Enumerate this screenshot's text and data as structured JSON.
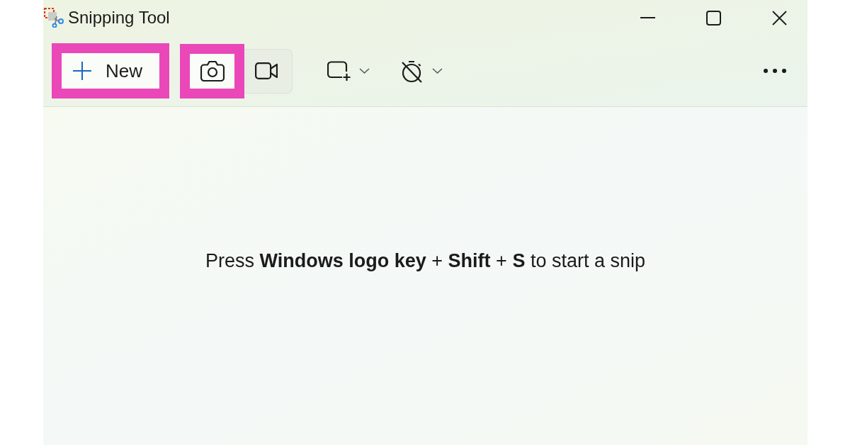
{
  "window": {
    "title": "Snipping Tool"
  },
  "toolbar": {
    "new_button": {
      "label": "New",
      "highlighted": true
    },
    "capture_modes": [
      {
        "kind": "screenshot",
        "selected": true,
        "highlighted": true
      },
      {
        "kind": "video",
        "selected": false,
        "highlighted": false
      }
    ]
  },
  "message": "Press **Windows logo key** + **Shift** + **S** to start a snip"
}
